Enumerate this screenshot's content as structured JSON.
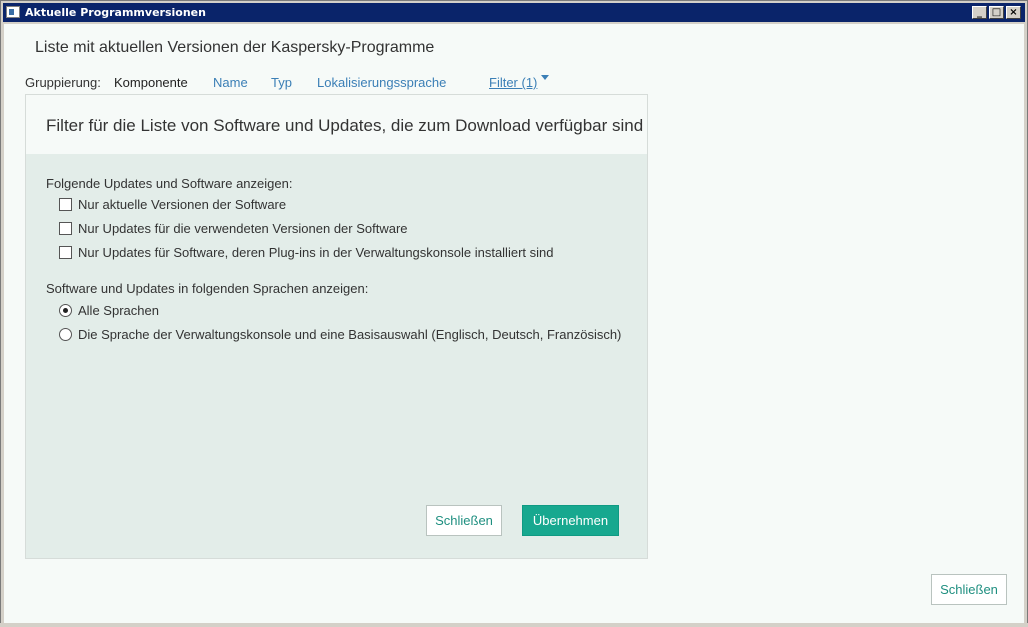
{
  "window": {
    "title": "Aktuelle Programmversionen",
    "minimize_label": "_",
    "maximize_label": "□",
    "close_label": "×"
  },
  "page": {
    "title": "Liste mit aktuellen Versionen der Kaspersky-Programme"
  },
  "grouping": {
    "label": "Gruppierung:",
    "active": "Komponente",
    "links": [
      "Name",
      "Typ",
      "Lokalisierungssprache"
    ],
    "filter": "Filter (1)"
  },
  "filter_panel": {
    "title": "Filter für die Liste von Software und Updates, die zum Download verfügbar sind",
    "section1_label": "Folgende Updates und Software anzeigen:",
    "checkboxes": [
      {
        "label": "Nur aktuelle Versionen der Software",
        "checked": false
      },
      {
        "label": "Nur Updates für die verwendeten Versionen der Software",
        "checked": false
      },
      {
        "label": "Nur Updates für Software, deren Plug-ins in der Verwaltungskonsole installiert sind",
        "checked": false
      }
    ],
    "section2_label": "Software und Updates in folgenden Sprachen anzeigen:",
    "radios": [
      {
        "label": "Alle Sprachen",
        "checked": true
      },
      {
        "label": "Die Sprache der Verwaltungskonsole und eine Basisauswahl (Englisch, Deutsch, Französisch)",
        "checked": false
      }
    ],
    "close_button": "Schließen",
    "apply_button": "Übernehmen"
  },
  "footer": {
    "close_button": "Schließen"
  },
  "colors": {
    "titlebar": "#0a246a",
    "link": "#3b7fb6",
    "primary": "#17a88f",
    "panel_bg": "#e3ede9"
  }
}
